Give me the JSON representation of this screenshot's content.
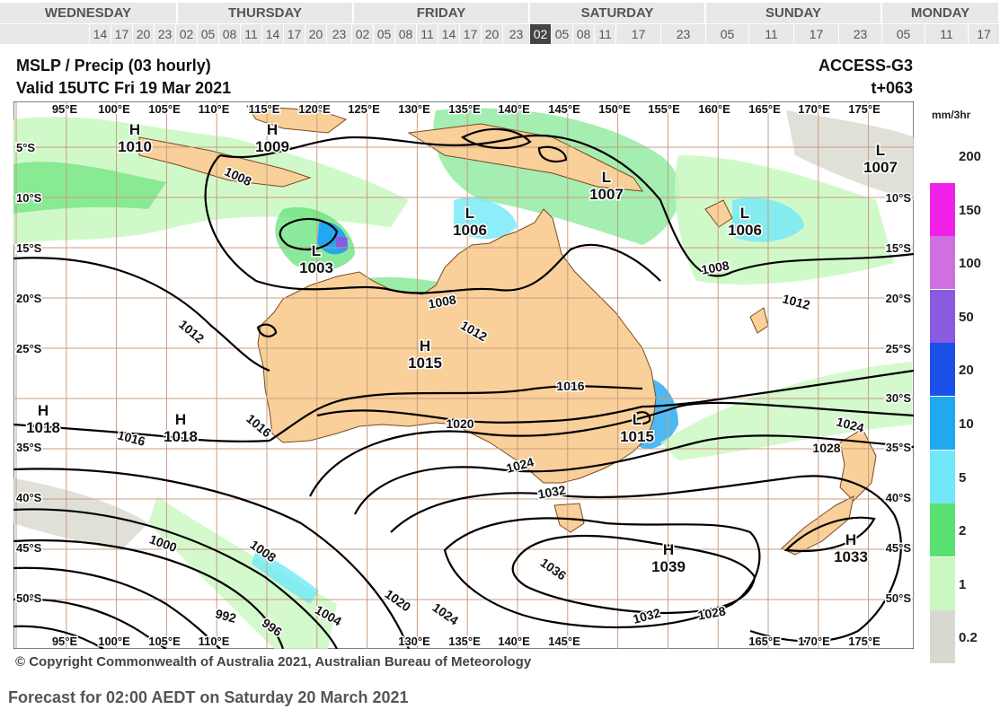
{
  "timeline": {
    "days": [
      "WEDNESDAY",
      "THURSDAY",
      "FRIDAY",
      "SATURDAY",
      "SUNDAY",
      "MONDAY"
    ],
    "hours": [
      "14",
      "17",
      "20",
      "23",
      "02",
      "05",
      "08",
      "11",
      "14",
      "17",
      "20",
      "23",
      "02",
      "05",
      "08",
      "11",
      "14",
      "17",
      "20",
      "23",
      "02",
      "05",
      "08",
      "11",
      "17",
      "23",
      "05",
      "11",
      "17",
      "23",
      "05",
      "11",
      "17"
    ],
    "selected_hour": "02"
  },
  "map": {
    "product": "MSLP / Precip  (03 hourly)",
    "model": "ACCESS-G3",
    "valid": "Valid 15UTC Fri 19 Mar 2021",
    "lead_time": "t+063",
    "top_lon_labels": [
      "95°E",
      "100°E",
      "105°E",
      "110°E",
      "115°E",
      "120°E",
      "125°E",
      "130°E",
      "135°E",
      "140°E",
      "145°E",
      "150°E",
      "155°E",
      "160°E",
      "165°E",
      "170°E",
      "175°E"
    ],
    "bottom_lon_labels": [
      "95°E",
      "100°E",
      "105°E",
      "110°E",
      "130°E",
      "135°E",
      "140°E",
      "145°E",
      "165°E",
      "170°E",
      "175°E"
    ],
    "left_lat_labels": [
      "5°S",
      "10°S",
      "15°S",
      "20°S",
      "25°S",
      "35°S",
      "40°S",
      "45°S",
      "50°S"
    ],
    "right_lat_labels": [
      "10°S",
      "15°S",
      "20°S",
      "25°S",
      "30°S",
      "35°S",
      "40°S",
      "45°S",
      "50°S"
    ],
    "pressure_centres": [
      {
        "type": "H",
        "value": "1010"
      },
      {
        "type": "H",
        "value": "1009"
      },
      {
        "type": "L",
        "value": "1003"
      },
      {
        "type": "L",
        "value": "1006"
      },
      {
        "type": "L",
        "value": "1007"
      },
      {
        "type": "L",
        "value": "1006"
      },
      {
        "type": "L",
        "value": "1007"
      },
      {
        "type": "H",
        "value": "1015"
      },
      {
        "type": "H",
        "value": "1018"
      },
      {
        "type": "H",
        "value": "1018"
      },
      {
        "type": "L",
        "value": "1015"
      },
      {
        "type": "H",
        "value": "1039"
      },
      {
        "type": "H",
        "value": "1033"
      }
    ],
    "isobar_labels": [
      "1008",
      "1008",
      "1008",
      "1012",
      "1012",
      "1012",
      "1016",
      "1016",
      "1016",
      "1020",
      "1024",
      "1024",
      "1028",
      "1032",
      "1036",
      "1000",
      "1008",
      "992",
      "996",
      "1004",
      "1020",
      "1024",
      "1032",
      "1028"
    ],
    "colors": {
      "land": "#f9cf9a",
      "ocean": "#ffffff",
      "grid": "#c89c80",
      "isobar": "#000000"
    }
  },
  "legend": {
    "unit": "mm/3hr",
    "levels": [
      {
        "label": "200",
        "color": "#ffffff"
      },
      {
        "label": "150",
        "color": "#f020e8"
      },
      {
        "label": "100",
        "color": "#d070e0"
      },
      {
        "label": "50",
        "color": "#8a5ae0"
      },
      {
        "label": "20",
        "color": "#1a50e8"
      },
      {
        "label": "10",
        "color": "#20a8f0"
      },
      {
        "label": "5",
        "color": "#70e8f8"
      },
      {
        "label": "2",
        "color": "#58e070"
      },
      {
        "label": "1",
        "color": "#c8f8c0"
      },
      {
        "label": "0.2",
        "color": "#d8d8d0"
      }
    ]
  },
  "footer": {
    "copyright": "© Copyright Commonwealth of Australia 2021, Australian Bureau of Meteorology",
    "forecast": "Forecast for 02:00 AEDT on Saturday 20 March 2021"
  }
}
